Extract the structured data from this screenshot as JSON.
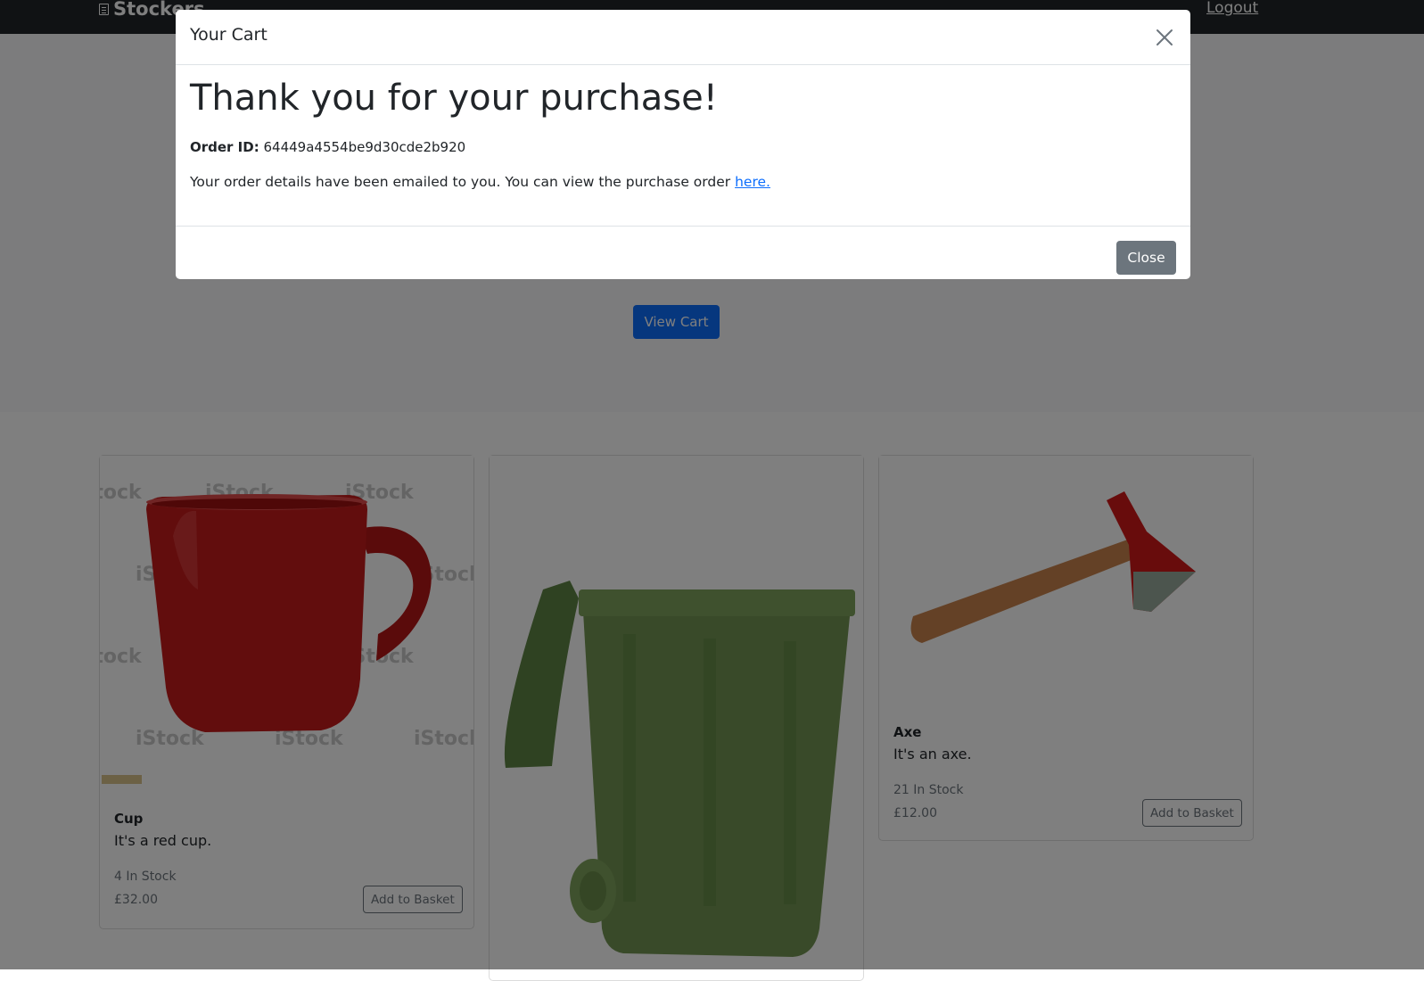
{
  "navbar": {
    "brand": "Stockers",
    "logout": "Logout"
  },
  "hero": {
    "view_cart": "View Cart"
  },
  "products": [
    {
      "name": "Cup",
      "description": "It's a red cup.",
      "stock": "4 In Stock",
      "price": "£32.00",
      "button": "Add to Basket"
    },
    {
      "name": "Bin",
      "description": "",
      "stock": "",
      "price": "",
      "button": ""
    },
    {
      "name": "Axe",
      "description": "It's an axe.",
      "stock": "21 In Stock",
      "price": "£12.00",
      "button": "Add to Basket"
    }
  ],
  "colors": {
    "primary": "#0d6efd",
    "secondary": "#6c757d",
    "navbar": "#212529",
    "cup_red": "#c01818",
    "bin_green": "#6f9250",
    "axe_handle": "#c9824c"
  },
  "modal": {
    "title": "Your Cart",
    "heading": "Thank you for your purchase!",
    "order_label": "Order ID:",
    "order_id": "64449a4554be9d30cde2b920",
    "details_text": "Your order details have been emailed to you. You can view the purchase order",
    "link_text": "here.",
    "close_button": "Close"
  }
}
